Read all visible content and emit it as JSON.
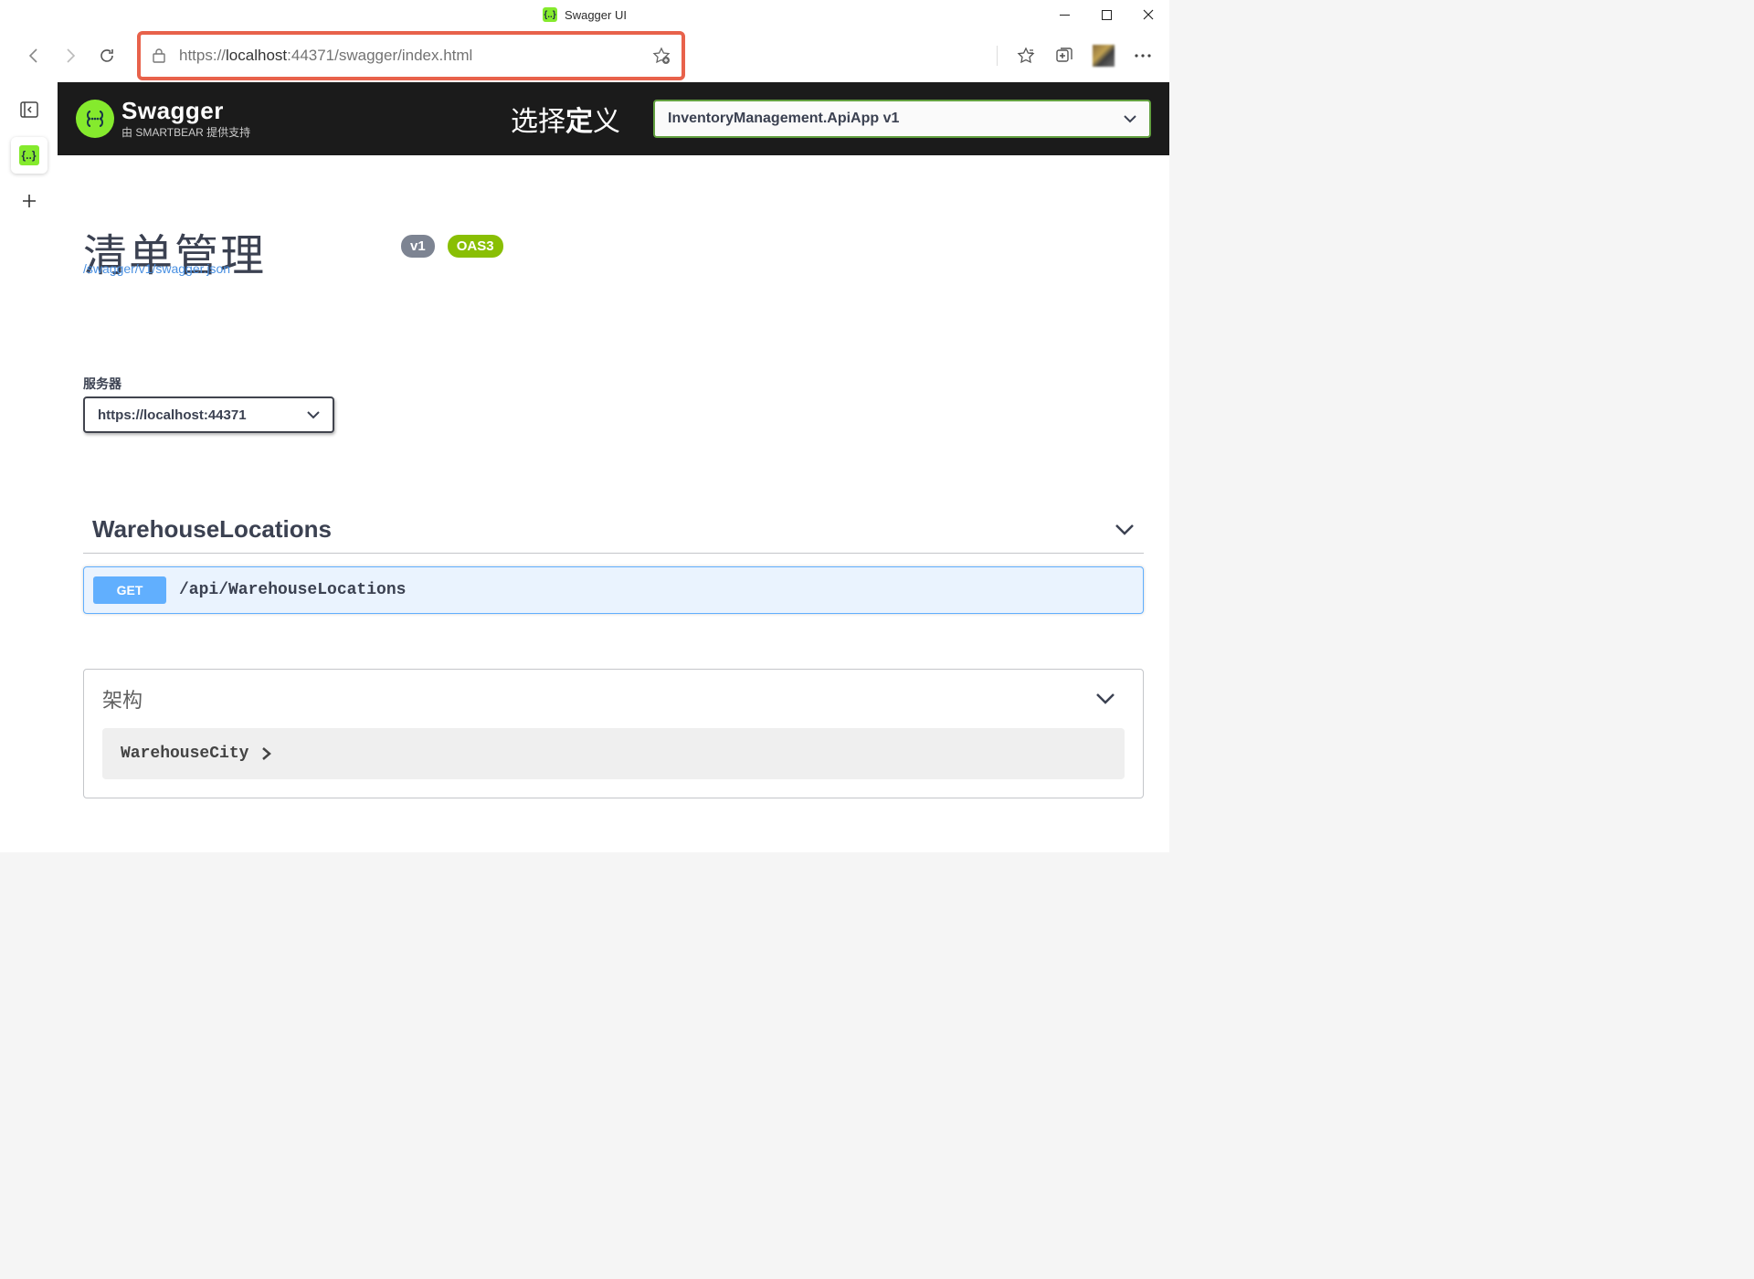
{
  "window": {
    "title": "Swagger UI"
  },
  "browser": {
    "url_prefix": "https://",
    "url_host": "localhost",
    "url_port": ":44371",
    "url_path": "/swagger/index.html"
  },
  "swaggerHeader": {
    "brand": "Swagger",
    "by": "由 SMARTBEAR 提供支持",
    "selectDef_thin1": "选择",
    "selectDef_bold": "定",
    "selectDef_thin2": "义",
    "definition": "InventoryManagement.ApiApp v1"
  },
  "api": {
    "title": "清单管理",
    "version_badge": "v1",
    "oas_badge": "OAS3",
    "json_link": "/swagger/v1/swagger.json"
  },
  "servers": {
    "label": "服务器",
    "selected": "https://localhost:44371"
  },
  "tag": {
    "name": "WarehouseLocations"
  },
  "operation": {
    "method": "GET",
    "path": "/api/WarehouseLocations"
  },
  "models": {
    "title": "架构",
    "item": "WarehouseCity"
  }
}
